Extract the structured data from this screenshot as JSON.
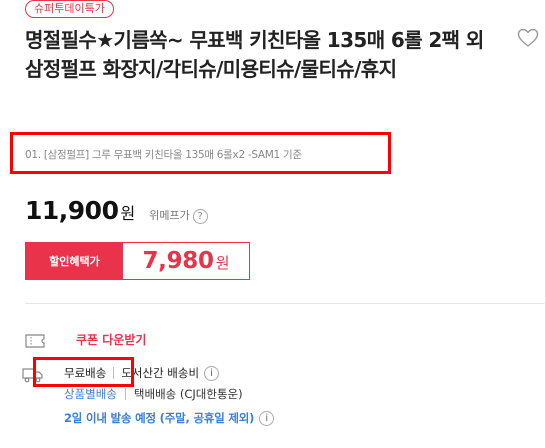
{
  "badge": "슈퍼투데이특가",
  "title": "명절필수★기름쏙~ 무표백 키친타올 135매 6롤 2팩 외 삼정펄프 화장지/각티슈/미용티슈/물티슈/휴지",
  "option": "01. [삼정펄프] 그루 무표백 키친타올 135매 6롤x2 -SAM1 기준",
  "price": {
    "value": "11,900",
    "unit": "원",
    "retail_label": "위메프가",
    "help_glyph": "?"
  },
  "discount": {
    "label": "할인혜택가",
    "value": "7,980",
    "unit": "원"
  },
  "coupon": {
    "label": "쿠폰 다운받기"
  },
  "shipping": {
    "free": "무료배송",
    "remote": "도서산간 배송비",
    "info_glyph": "i",
    "method_label": "상품별배송",
    "method_value": "택배배송 (CJ대한통운)",
    "eta": "2일 이내 발송 예정 (주말, 공휴일 제외)"
  },
  "colors": {
    "accent": "#e8334a",
    "highlight": "#ff0000",
    "link": "#3c7fd8"
  },
  "icons": {
    "wish": "heart-icon",
    "coupon": "coupon-icon",
    "shipping": "truck-icon"
  }
}
